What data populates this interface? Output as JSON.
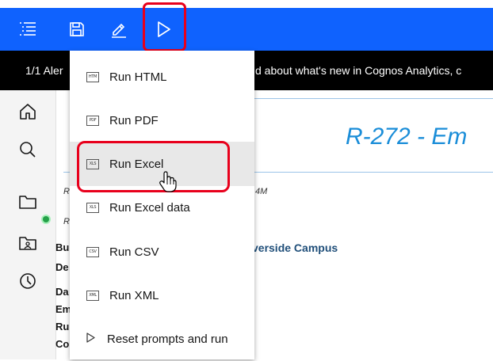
{
  "toolbar": {
    "buttons": [
      {
        "name": "toc-icon",
        "label": "Table of contents"
      },
      {
        "name": "save-icon",
        "label": "Save"
      },
      {
        "name": "edit-icon",
        "label": "Edit"
      },
      {
        "name": "run-icon",
        "label": "Run"
      }
    ]
  },
  "alert": {
    "count": "1/1 Aler",
    "message": "d about what's new in Cognos Analytics, c"
  },
  "rail": {
    "icons": [
      "home-icon",
      "search-icon",
      "folder-icon",
      "team-folder-icon",
      "recent-icon"
    ]
  },
  "report": {
    "title": "R-272 - Em",
    "meta1_prefix": "R",
    "meta1_suffix": "4M",
    "meta2_prefix": "R",
    "labels": [
      "Bu",
      "De",
      "Da",
      "Em",
      "Ru",
      "Co"
    ],
    "campus": "verside Campus"
  },
  "run_menu": {
    "items": [
      {
        "icon_text": "HTM",
        "label": "Run HTML"
      },
      {
        "icon_text": "PDF",
        "label": "Run PDF"
      },
      {
        "icon_text": "XLS",
        "label": "Run Excel"
      },
      {
        "icon_text": "XLS",
        "label": "Run Excel data"
      },
      {
        "icon_text": "CSV",
        "label": "Run CSV"
      },
      {
        "icon_text": "XML",
        "label": "Run XML"
      },
      {
        "icon_text": "",
        "label": "Reset prompts and run"
      }
    ],
    "hovered_index": 2
  },
  "colors": {
    "toolbar_bg": "#0f62fe",
    "highlight": "#e8001c",
    "title_blue": "#1a8dd8",
    "status_green": "#24a148"
  }
}
